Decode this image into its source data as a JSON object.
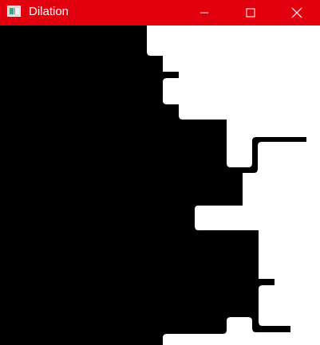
{
  "window": {
    "title": "Dilation",
    "title_bar_color": "#e2000f",
    "title_text_color": "#ffffff"
  },
  "controls": {
    "minimize_icon": "minimize-icon",
    "maximize_icon": "maximize-icon",
    "close_icon": "close-icon"
  },
  "image_view": {
    "foreground_color": "#000000",
    "background_color": "#ffffff"
  }
}
